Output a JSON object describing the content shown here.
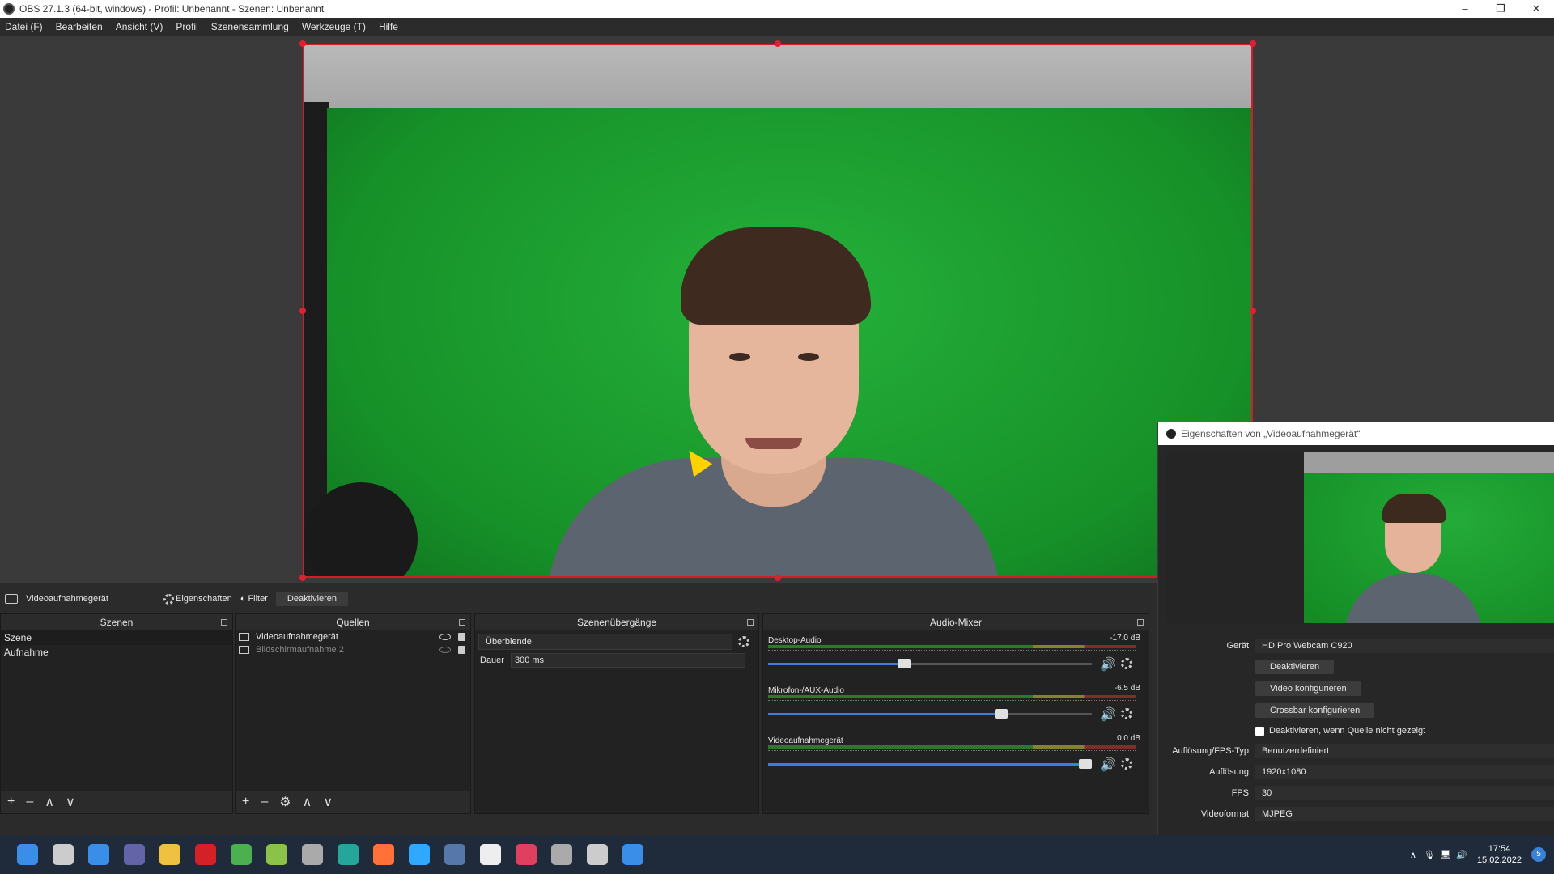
{
  "window": {
    "title": "OBS 27.1.3 (64-bit, windows) - Profil: Unbenannt - Szenen: Unbenannt",
    "controls": [
      "–",
      "❐",
      "✕"
    ]
  },
  "menu": [
    "Datei (F)",
    "Bearbeiten",
    "Ansicht (V)",
    "Profil",
    "Szenensammlung",
    "Werkzeuge (T)",
    "Hilfe"
  ],
  "source_toolbar": {
    "source_name": "Videoaufnahmegerät",
    "properties": "Eigenschaften",
    "filter": "Filter",
    "deactivate": "Deaktivieren"
  },
  "scenes": {
    "title": "Szenen",
    "items": [
      "Szene",
      "Aufnahme"
    ],
    "footer": [
      "+",
      "–",
      "∧",
      "∨"
    ]
  },
  "sources": {
    "title": "Quellen",
    "items": [
      {
        "name": "Videoaufnahmegerät",
        "visible": true
      },
      {
        "name": "Bildschirmaufnahme 2",
        "visible": false
      }
    ],
    "footer": [
      "+",
      "–",
      "⚙",
      "∧",
      "∨"
    ]
  },
  "transitions": {
    "title": "Szenenübergänge",
    "selected": "Überblende",
    "duration_label": "Dauer",
    "duration_value": "300 ms"
  },
  "mixer": {
    "title": "Audio-Mixer",
    "channels": [
      {
        "name": "Desktop-Audio",
        "db": "-17.0 dB",
        "volume": 0.44
      },
      {
        "name": "Mikrofon-/AUX-Audio",
        "db": "-6.5 dB",
        "volume": 0.74
      },
      {
        "name": "Videoaufnahmegerät",
        "db": "0.0 dB",
        "volume": 1.0
      }
    ],
    "speaker_icon": "🔊"
  },
  "properties": {
    "title": "Eigenschaften von „Videoaufnahmegerät“",
    "device_label": "Gerät",
    "device_value": "HD Pro Webcam C920",
    "btn_deactivate": "Deaktivieren",
    "btn_video_config": "Video konfigurieren",
    "btn_crossbar": "Crossbar konfigurieren",
    "checkbox_label": "Deaktivieren, wenn Quelle nicht gezeigt",
    "res_type_label": "Auflösung/FPS-Typ",
    "res_type_value": "Benutzerdefiniert",
    "resolution_label": "Auflösung",
    "resolution_value": "1920x1080",
    "fps_label": "FPS",
    "fps_value": "30",
    "format_label": "Videoformat",
    "format_value": "MJPEG"
  },
  "taskbar": {
    "time": "17:54",
    "date": "15.02.2022",
    "notification_count": "5",
    "app_colors": [
      "#3b8ee8",
      "#cccccc",
      "#3b8ee8",
      "#6264a7",
      "#f0c040",
      "#d42027",
      "#4caf50",
      "#8bc34a",
      "#aaaaaa",
      "#26a69a",
      "#ff7139",
      "#31a8ff",
      "#5577aa",
      "#eeeeee",
      "#e04060",
      "#aaaaaa",
      "#cccccc",
      "#3b8ee8"
    ]
  }
}
